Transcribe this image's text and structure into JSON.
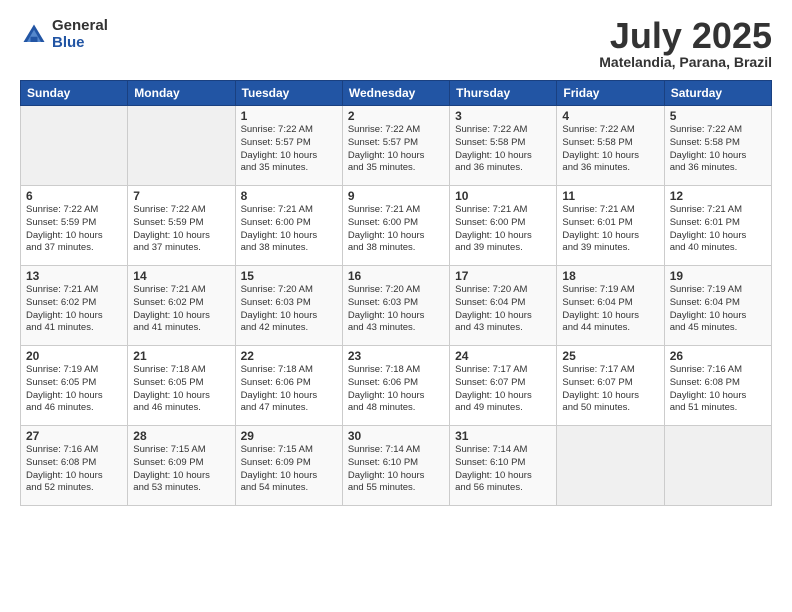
{
  "header": {
    "logo_general": "General",
    "logo_blue": "Blue",
    "month_title": "July 2025",
    "subtitle": "Matelandia, Parana, Brazil"
  },
  "days_of_week": [
    "Sunday",
    "Monday",
    "Tuesday",
    "Wednesday",
    "Thursday",
    "Friday",
    "Saturday"
  ],
  "weeks": [
    [
      {
        "day": "",
        "info": ""
      },
      {
        "day": "",
        "info": ""
      },
      {
        "day": "1",
        "info": "Sunrise: 7:22 AM\nSunset: 5:57 PM\nDaylight: 10 hours\nand 35 minutes."
      },
      {
        "day": "2",
        "info": "Sunrise: 7:22 AM\nSunset: 5:57 PM\nDaylight: 10 hours\nand 35 minutes."
      },
      {
        "day": "3",
        "info": "Sunrise: 7:22 AM\nSunset: 5:58 PM\nDaylight: 10 hours\nand 36 minutes."
      },
      {
        "day": "4",
        "info": "Sunrise: 7:22 AM\nSunset: 5:58 PM\nDaylight: 10 hours\nand 36 minutes."
      },
      {
        "day": "5",
        "info": "Sunrise: 7:22 AM\nSunset: 5:58 PM\nDaylight: 10 hours\nand 36 minutes."
      }
    ],
    [
      {
        "day": "6",
        "info": "Sunrise: 7:22 AM\nSunset: 5:59 PM\nDaylight: 10 hours\nand 37 minutes."
      },
      {
        "day": "7",
        "info": "Sunrise: 7:22 AM\nSunset: 5:59 PM\nDaylight: 10 hours\nand 37 minutes."
      },
      {
        "day": "8",
        "info": "Sunrise: 7:21 AM\nSunset: 6:00 PM\nDaylight: 10 hours\nand 38 minutes."
      },
      {
        "day": "9",
        "info": "Sunrise: 7:21 AM\nSunset: 6:00 PM\nDaylight: 10 hours\nand 38 minutes."
      },
      {
        "day": "10",
        "info": "Sunrise: 7:21 AM\nSunset: 6:00 PM\nDaylight: 10 hours\nand 39 minutes."
      },
      {
        "day": "11",
        "info": "Sunrise: 7:21 AM\nSunset: 6:01 PM\nDaylight: 10 hours\nand 39 minutes."
      },
      {
        "day": "12",
        "info": "Sunrise: 7:21 AM\nSunset: 6:01 PM\nDaylight: 10 hours\nand 40 minutes."
      }
    ],
    [
      {
        "day": "13",
        "info": "Sunrise: 7:21 AM\nSunset: 6:02 PM\nDaylight: 10 hours\nand 41 minutes."
      },
      {
        "day": "14",
        "info": "Sunrise: 7:21 AM\nSunset: 6:02 PM\nDaylight: 10 hours\nand 41 minutes."
      },
      {
        "day": "15",
        "info": "Sunrise: 7:20 AM\nSunset: 6:03 PM\nDaylight: 10 hours\nand 42 minutes."
      },
      {
        "day": "16",
        "info": "Sunrise: 7:20 AM\nSunset: 6:03 PM\nDaylight: 10 hours\nand 43 minutes."
      },
      {
        "day": "17",
        "info": "Sunrise: 7:20 AM\nSunset: 6:04 PM\nDaylight: 10 hours\nand 43 minutes."
      },
      {
        "day": "18",
        "info": "Sunrise: 7:19 AM\nSunset: 6:04 PM\nDaylight: 10 hours\nand 44 minutes."
      },
      {
        "day": "19",
        "info": "Sunrise: 7:19 AM\nSunset: 6:04 PM\nDaylight: 10 hours\nand 45 minutes."
      }
    ],
    [
      {
        "day": "20",
        "info": "Sunrise: 7:19 AM\nSunset: 6:05 PM\nDaylight: 10 hours\nand 46 minutes."
      },
      {
        "day": "21",
        "info": "Sunrise: 7:18 AM\nSunset: 6:05 PM\nDaylight: 10 hours\nand 46 minutes."
      },
      {
        "day": "22",
        "info": "Sunrise: 7:18 AM\nSunset: 6:06 PM\nDaylight: 10 hours\nand 47 minutes."
      },
      {
        "day": "23",
        "info": "Sunrise: 7:18 AM\nSunset: 6:06 PM\nDaylight: 10 hours\nand 48 minutes."
      },
      {
        "day": "24",
        "info": "Sunrise: 7:17 AM\nSunset: 6:07 PM\nDaylight: 10 hours\nand 49 minutes."
      },
      {
        "day": "25",
        "info": "Sunrise: 7:17 AM\nSunset: 6:07 PM\nDaylight: 10 hours\nand 50 minutes."
      },
      {
        "day": "26",
        "info": "Sunrise: 7:16 AM\nSunset: 6:08 PM\nDaylight: 10 hours\nand 51 minutes."
      }
    ],
    [
      {
        "day": "27",
        "info": "Sunrise: 7:16 AM\nSunset: 6:08 PM\nDaylight: 10 hours\nand 52 minutes."
      },
      {
        "day": "28",
        "info": "Sunrise: 7:15 AM\nSunset: 6:09 PM\nDaylight: 10 hours\nand 53 minutes."
      },
      {
        "day": "29",
        "info": "Sunrise: 7:15 AM\nSunset: 6:09 PM\nDaylight: 10 hours\nand 54 minutes."
      },
      {
        "day": "30",
        "info": "Sunrise: 7:14 AM\nSunset: 6:10 PM\nDaylight: 10 hours\nand 55 minutes."
      },
      {
        "day": "31",
        "info": "Sunrise: 7:14 AM\nSunset: 6:10 PM\nDaylight: 10 hours\nand 56 minutes."
      },
      {
        "day": "",
        "info": ""
      },
      {
        "day": "",
        "info": ""
      }
    ]
  ]
}
